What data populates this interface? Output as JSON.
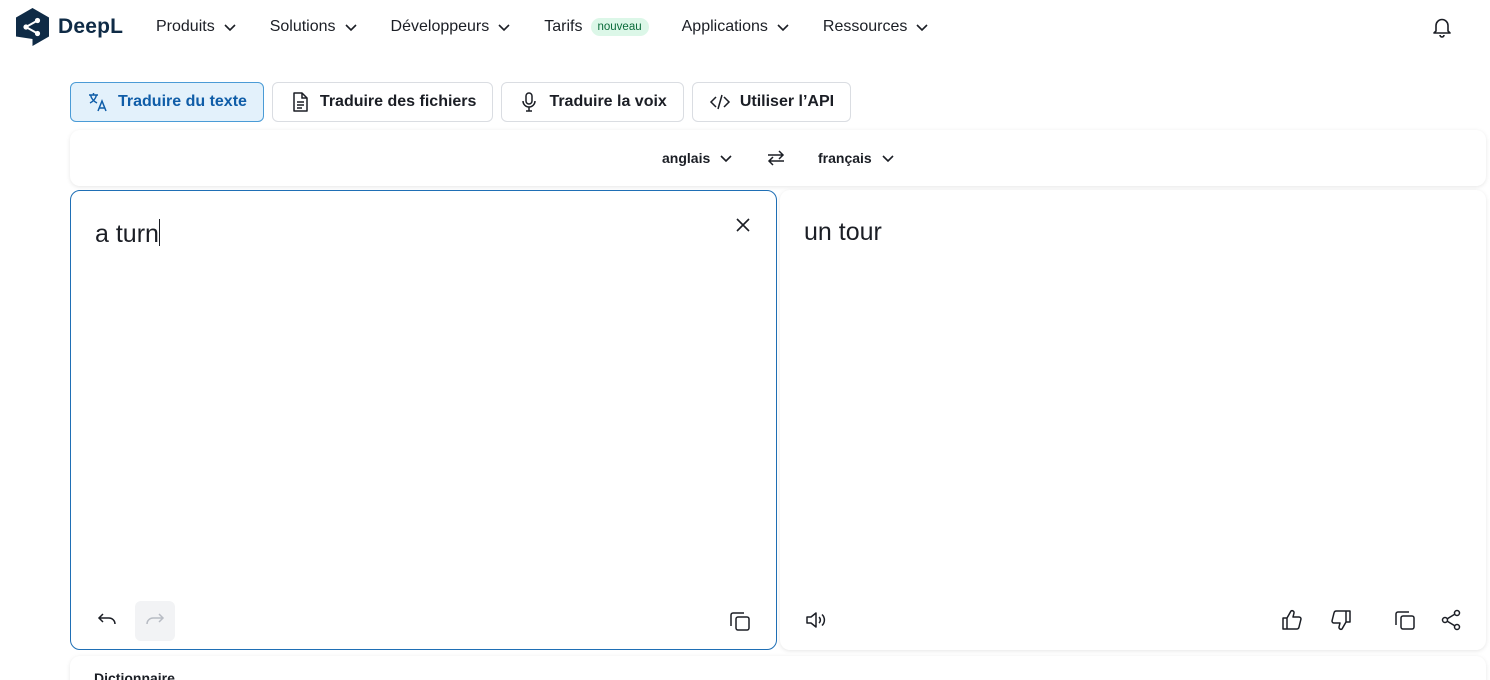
{
  "brand": {
    "name": "DeepL"
  },
  "nav": {
    "items": [
      {
        "label": "Produits",
        "has_dropdown": true
      },
      {
        "label": "Solutions",
        "has_dropdown": true
      },
      {
        "label": "Développeurs",
        "has_dropdown": true
      },
      {
        "label": "Tarifs",
        "has_dropdown": false,
        "badge": "nouveau"
      },
      {
        "label": "Applications",
        "has_dropdown": true
      },
      {
        "label": "Ressources",
        "has_dropdown": true
      }
    ],
    "bell_icon": "bell-icon"
  },
  "modes": {
    "items": [
      {
        "label": "Traduire du texte",
        "icon": "translate-icon",
        "active": true
      },
      {
        "label": "Traduire des fichiers",
        "icon": "document-icon",
        "active": false
      },
      {
        "label": "Traduire la voix",
        "icon": "microphone-icon",
        "active": false
      },
      {
        "label": "Utiliser l’API",
        "icon": "code-icon",
        "active": false
      }
    ]
  },
  "languages": {
    "source": "anglais",
    "target": "français",
    "swap_icon": "swap-icon"
  },
  "source_panel": {
    "text": "a turn",
    "icons": [
      "close-icon",
      "undo-icon",
      "redo-icon",
      "copy-icon"
    ]
  },
  "target_panel": {
    "text": "un tour",
    "icons": [
      "speaker-icon",
      "thumbs-up-icon",
      "thumbs-down-icon",
      "copy-icon",
      "share-icon"
    ]
  },
  "dictionary": {
    "title": "Dictionnaire"
  },
  "colors": {
    "accent": "#1f6fb5",
    "active_tab_bg": "#e3f1fb",
    "active_tab_text": "#0f5da8",
    "badge_bg": "#dcf7e8",
    "brand_dark": "#0f2b46"
  }
}
